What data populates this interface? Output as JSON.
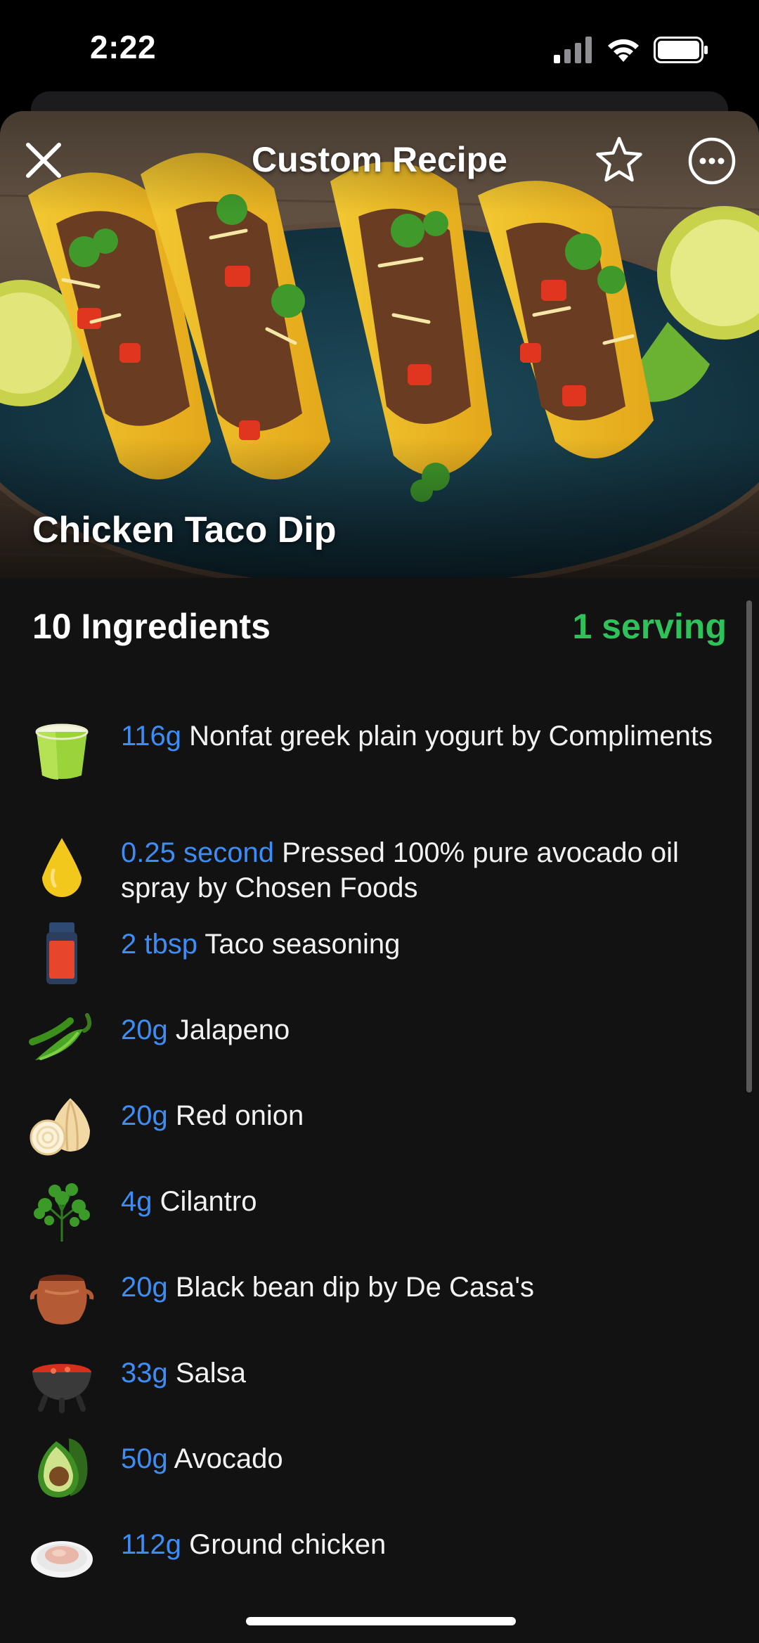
{
  "status_bar": {
    "time": "2:22"
  },
  "header": {
    "title": "Custom Recipe",
    "recipe_name": "Chicken Taco Dip"
  },
  "ingredients": {
    "heading": "10 Ingredients",
    "servings": "1 serving",
    "items": [
      {
        "amount": "116g",
        "name": "Nonfat greek plain yogurt by Compliments",
        "icon": "yogurt-icon"
      },
      {
        "amount": "0.25 second",
        "name": "Pressed 100% pure avocado oil spray by Chosen Foods",
        "icon": "oil-drop-icon"
      },
      {
        "amount": "2 tbsp",
        "name": "Taco seasoning",
        "icon": "spice-jar-icon"
      },
      {
        "amount": "20g",
        "name": "Jalapeno",
        "icon": "jalapeno-icon"
      },
      {
        "amount": "20g",
        "name": "Red onion",
        "icon": "onion-icon"
      },
      {
        "amount": "4g",
        "name": "Cilantro",
        "icon": "cilantro-icon"
      },
      {
        "amount": "20g",
        "name": "Black bean dip by De Casa's",
        "icon": "bean-pot-icon"
      },
      {
        "amount": "33g",
        "name": "Salsa",
        "icon": "salsa-bowl-icon"
      },
      {
        "amount": "50g",
        "name": "Avocado",
        "icon": "avocado-icon"
      },
      {
        "amount": "112g",
        "name": "Ground chicken",
        "icon": "ground-meat-icon"
      }
    ]
  },
  "colors": {
    "background": "#121212",
    "amount_blue": "#3d8df5",
    "serving_green": "#2fc25b"
  }
}
